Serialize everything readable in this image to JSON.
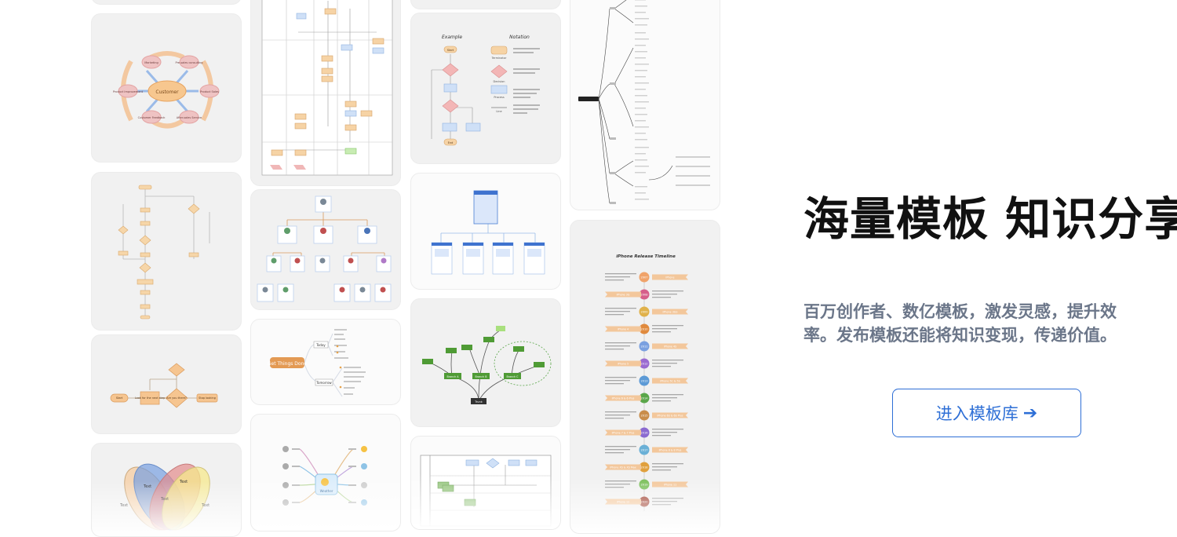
{
  "hero": {
    "title": "海量模板 知识分享",
    "subtitle": "百万创作者、数亿模板，激发灵感，提升效率。发布模板还能将知识变现，传递价值。",
    "cta_label": "进入模板库",
    "cta_arrow": "➔",
    "accent_color": "#2e6fd6"
  },
  "templates": {
    "customer_map": {
      "center": "Customer",
      "nodes": [
        "Marketing",
        "Pre-sales consulting",
        "Product Sales",
        "After-sales Service",
        "Customer Feedback",
        "Product Improvement"
      ]
    },
    "flowchart_notation": {
      "example_label": "Example",
      "notation_label": "Notation",
      "shapes": [
        "Terminator",
        "Decision",
        "Process",
        "Line"
      ],
      "steps": [
        "Start",
        "End"
      ]
    },
    "things_done": {
      "center": "Get Things Done",
      "branches": [
        "Today",
        "Tomorrow"
      ]
    },
    "weather": {
      "center": "Weather"
    },
    "tree": {
      "root": "Trunk",
      "branches": [
        "Branch A",
        "Branch B",
        "Branch C"
      ]
    },
    "timeline": {
      "title": "iPhone Release Timeline",
      "years": [
        "2007",
        "2008",
        "2009",
        "2010",
        "2011",
        "2012",
        "2013",
        "2014",
        "2015",
        "2016",
        "2017",
        "2018",
        "2019",
        "2020"
      ],
      "models": [
        "iPhone",
        "iPhone 3G",
        "iPhone 3GS",
        "iPhone 4",
        "iPhone 4S",
        "iPhone 5",
        "iPhone 5C & 5S",
        "iPhone 6 & 6 Plus",
        "iPhone 6S & 6S Plus",
        "iPhone 7 & 7 Plus",
        "iPhone 8 & 8 Plus",
        "iPhone XS & XS Max",
        "iPhone 11",
        "iPhone 12"
      ]
    },
    "if_then": {
      "nodes": [
        "Start",
        "Look for the next step",
        "Are you there?",
        "Stop looking"
      ]
    },
    "venn": {
      "label": "Text"
    }
  }
}
